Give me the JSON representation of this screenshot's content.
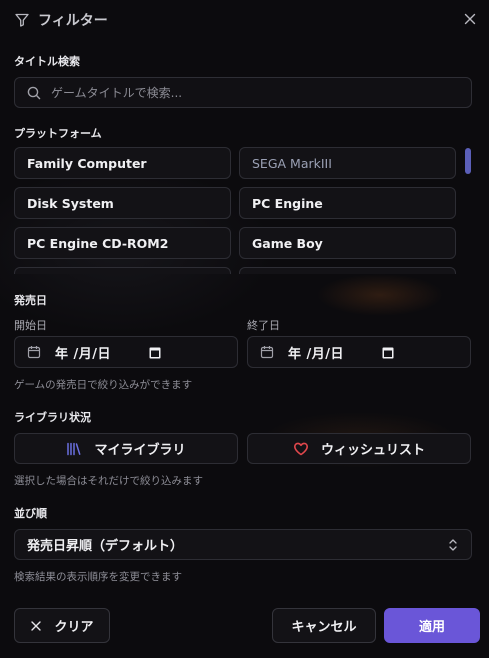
{
  "header": {
    "title": "フィルター"
  },
  "title_search": {
    "label": "タイトル検索",
    "placeholder": "ゲームタイトルで検索..."
  },
  "platform": {
    "label": "プラットフォーム",
    "items": [
      {
        "label": "Family Computer"
      },
      {
        "label": "SEGA MarkIII"
      },
      {
        "label": "Disk System"
      },
      {
        "label": "PC Engine"
      },
      {
        "label": "PC Engine CD-ROM2"
      },
      {
        "label": "Game Boy"
      }
    ]
  },
  "release_date": {
    "label": "発売日",
    "start_label": "開始日",
    "end_label": "終了日",
    "start_value": "年 /月/日",
    "end_value": "年 /月/日",
    "hint": "ゲームの発売日で絞り込みができます"
  },
  "library": {
    "label": "ライブラリ状況",
    "my_library": "マイライブラリ",
    "wishlist": "ウィッシュリスト",
    "hint": "選択した場合はそれだけで絞り込みます"
  },
  "sort": {
    "label": "並び順",
    "selected": "発売日昇順（デフォルト）",
    "hint": "検索結果の表示順序を変更できます"
  },
  "footer": {
    "clear": "クリア",
    "cancel": "キャンセル",
    "apply": "適用"
  },
  "colors": {
    "accent": "#6a56d8",
    "heart": "#e0474c",
    "library_icon": "#6b6fe0"
  }
}
